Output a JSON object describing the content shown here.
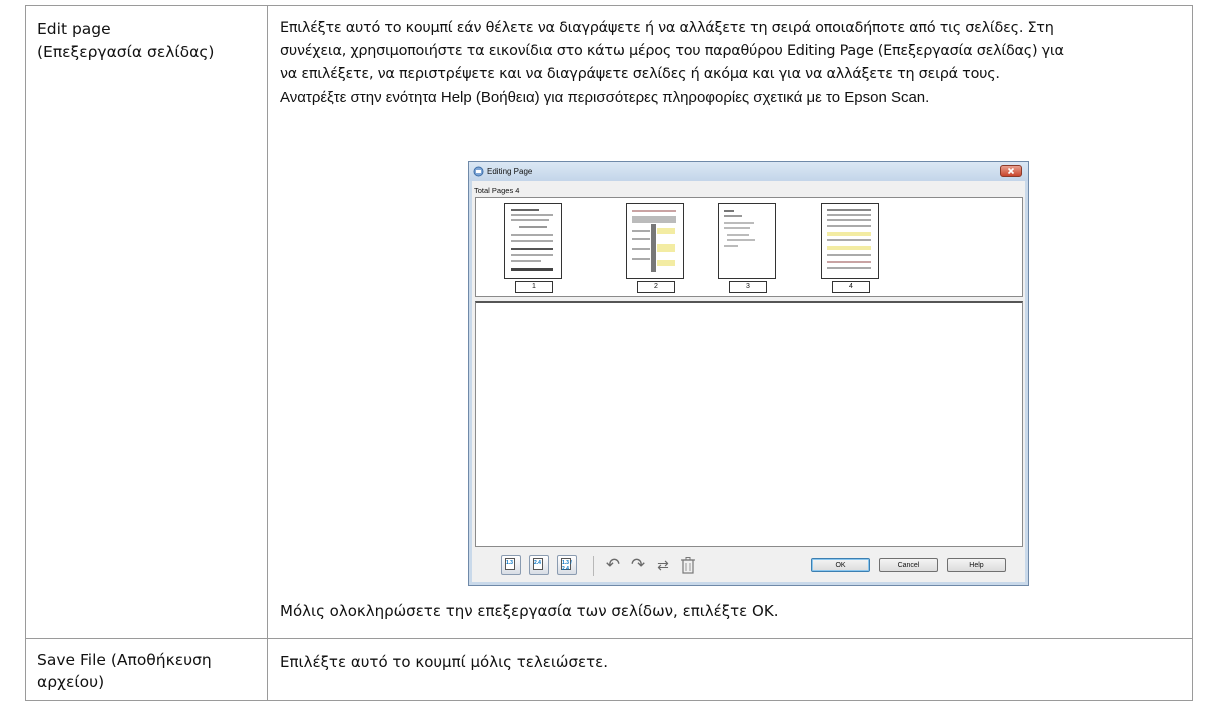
{
  "rows": [
    {
      "label_lines": [
        "Edit page",
        "(Επεξεργασία σελίδας)"
      ],
      "description_lines": [
        "Επιλέξτε αυτό το κουμπί εάν θέλετε να διαγράψετε ή να αλλάξετε τη σειρά οποιαδήποτε από τις σελίδες. Στη",
        "συνέχεια, χρησιμοποιήστε τα εικονίδια στο κάτω μέρος του παραθύρου Editing Page (Επεξεργασία σελίδας) για",
        "να επιλέξετε, να περιστρέψετε και να διαγράψετε σελίδες ή ακόμα και για να αλλάξετε τη σειρά τους.",
        "Ανατρέξτε στην ενότητα Help (Βοήθεια) για περισσότερες πληροφορίες σχετικά με το Epson Scan."
      ],
      "footer": "Μόλις ολοκληρώσετε την επεξεργασία των σελίδων, επιλέξτε OK."
    },
    {
      "label_lines": [
        "Save File (Αποθήκευση",
        "αρχείου)"
      ],
      "description": "Επιλέξτε αυτό το κουμπί μόλις τελειώσετε."
    }
  ],
  "dialog": {
    "title": "Editing Page",
    "total_pages_label": "Total Pages 4",
    "pages": [
      "1",
      "2",
      "3",
      "4"
    ],
    "buttons": {
      "ok": "OK",
      "cancel": "Cancel",
      "help": "Help"
    },
    "toolbar_icons": [
      "1.3",
      "2.4",
      "1.3 / 2.4"
    ]
  }
}
